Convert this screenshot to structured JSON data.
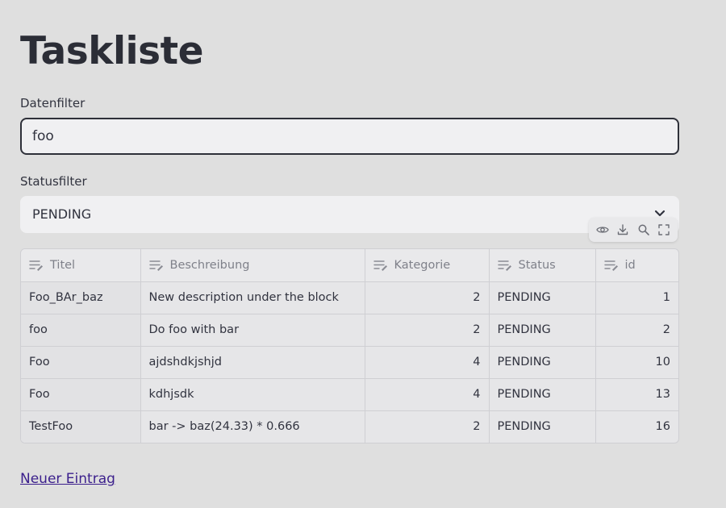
{
  "page": {
    "title": "Taskliste"
  },
  "filters": {
    "data_label": "Datenfilter",
    "data_value": "foo",
    "status_label": "Statusfilter",
    "status_value": "PENDING"
  },
  "toolbar": {
    "icons": [
      "eye-icon",
      "download-icon",
      "search-icon",
      "fullscreen-icon"
    ]
  },
  "table": {
    "columns": [
      "Titel",
      "Beschreibung",
      "Kategorie",
      "Status",
      "id"
    ],
    "rows": [
      [
        "Foo_BAr_baz",
        "New description under the block",
        "2",
        "PENDING",
        "1"
      ],
      [
        "foo",
        "Do foo with bar",
        "2",
        "PENDING",
        "2"
      ],
      [
        "Foo",
        "ajdshdkjshjd",
        "4",
        "PENDING",
        "10"
      ],
      [
        "Foo",
        "kdhjsdk",
        "4",
        "PENDING",
        "13"
      ],
      [
        "TestFoo",
        "bar -> baz(24.33) * 0.666",
        "2",
        "PENDING",
        "16"
      ]
    ]
  },
  "footer": {
    "new_entry_link": "Neuer Eintrag"
  },
  "colors": {
    "background": "#dfdfdf",
    "link": "#3b1f8c",
    "title": "#2b2d36"
  }
}
